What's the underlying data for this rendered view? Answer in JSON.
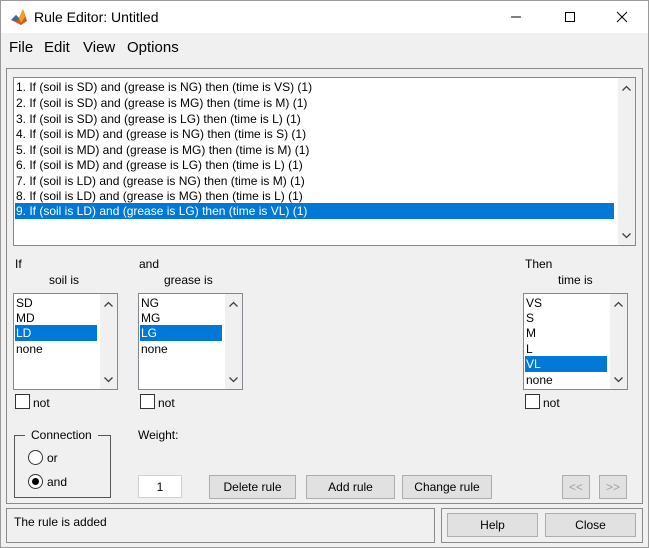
{
  "window": {
    "title": "Rule Editor: Untitled"
  },
  "menu": [
    "File",
    "Edit",
    "View",
    "Options"
  ],
  "rules": {
    "items": [
      "1. If (soil is SD) and (grease is NG) then (time is VS) (1)",
      "2. If (soil is SD) and (grease is MG) then (time is M) (1)",
      "3. If (soil is SD) and (grease is LG) then (time is L) (1)",
      "4. If (soil is MD) and (grease is NG) then (time is S) (1)",
      "5. If (soil is MD) and (grease is MG) then (time is M) (1)",
      "6. If (soil is MD) and (grease is LG) then (time is L) (1)",
      "7. If (soil is LD) and (grease is NG) then (time is M) (1)",
      "8. If (soil is LD) and (grease is MG) then (time is L) (1)",
      "9. If (soil is LD) and (grease is LG) then (time is VL) (1)"
    ],
    "selected": "9. If (soil is LD) and (grease is LG) then (time is VL) (1)"
  },
  "inputs": {
    "if_label": "If",
    "soil": {
      "label": "soil is",
      "items": [
        "SD",
        "MD",
        "LD",
        "none"
      ],
      "selected": "LD",
      "not_label": "not"
    },
    "and_label": "and",
    "grease": {
      "label": "grease is",
      "items": [
        "NG",
        "MG",
        "LG",
        "none"
      ],
      "selected": "LG",
      "not_label": "not"
    }
  },
  "output": {
    "then_label": "Then",
    "time": {
      "label": "time is",
      "items": [
        "VS",
        "S",
        "M",
        "L",
        "VL",
        "none"
      ],
      "selected": "VL",
      "not_label": "not"
    }
  },
  "connection": {
    "title": "Connection",
    "options": [
      "or",
      "and"
    ],
    "selected": "and"
  },
  "weight": {
    "label": "Weight:",
    "value": "1"
  },
  "buttons": {
    "delete_rule": "Delete rule",
    "add_rule": "Add rule",
    "change_rule": "Change rule",
    "prev": "<<",
    "next": ">>",
    "help": "Help",
    "close": "Close"
  },
  "status": {
    "text": "The rule is added"
  },
  "colors": {
    "selection": "#0078d7",
    "panel": "#f0f0f0"
  }
}
